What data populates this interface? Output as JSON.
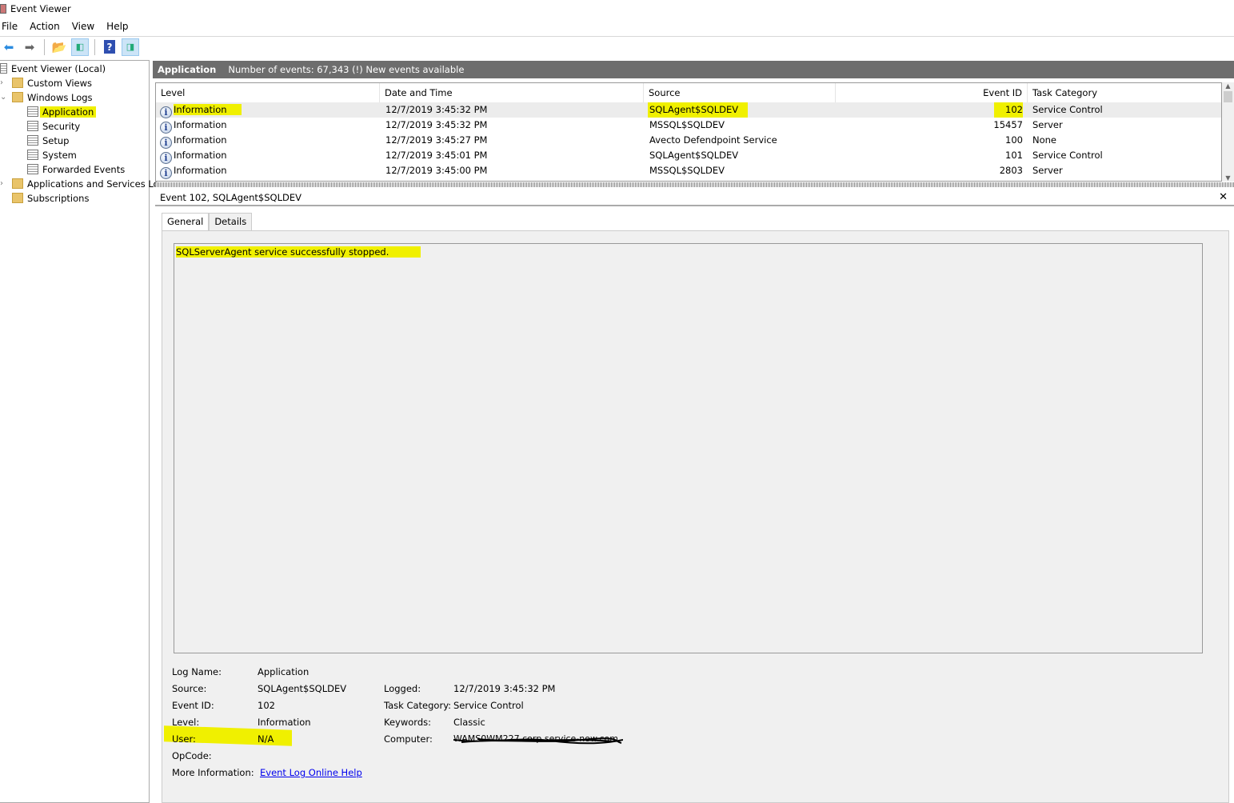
{
  "window": {
    "title": "Event Viewer"
  },
  "menu": [
    "File",
    "Action",
    "View",
    "Help"
  ],
  "toolbar": {
    "icons": [
      "back-arrow-icon",
      "forward-arrow-icon",
      "up-folder-icon",
      "show-hide-tree-icon",
      "help-icon",
      "show-hide-action-pane-icon"
    ]
  },
  "tree": {
    "root": "Event Viewer (Local)",
    "custom_views": "Custom Views",
    "windows_logs": "Windows Logs",
    "logs": [
      "Application",
      "Security",
      "Setup",
      "System",
      "Forwarded Events"
    ],
    "app_services": "Applications and Services Lo",
    "subscriptions": "Subscriptions"
  },
  "header": {
    "title": "Application",
    "summary": "Number of events: 67,343 (!) New events available"
  },
  "grid": {
    "columns": [
      "Level",
      "Date and Time",
      "Source",
      "Event ID",
      "Task Category"
    ],
    "rows": [
      {
        "level": "Information",
        "date": "12/7/2019 3:45:32 PM",
        "source": "SQLAgent$SQLDEV",
        "id": "102",
        "category": "Service Control"
      },
      {
        "level": "Information",
        "date": "12/7/2019 3:45:32 PM",
        "source": "MSSQL$SQLDEV",
        "id": "15457",
        "category": "Server"
      },
      {
        "level": "Information",
        "date": "12/7/2019 3:45:27 PM",
        "source": "Avecto Defendpoint Service",
        "id": "100",
        "category": "None"
      },
      {
        "level": "Information",
        "date": "12/7/2019 3:45:01 PM",
        "source": "SQLAgent$SQLDEV",
        "id": "101",
        "category": "Service Control"
      },
      {
        "level": "Information",
        "date": "12/7/2019 3:45:00 PM",
        "source": "MSSQL$SQLDEV",
        "id": "2803",
        "category": "Server"
      }
    ]
  },
  "event": {
    "title": "Event 102, SQLAgent$SQLDEV",
    "tabs": [
      "General",
      "Details"
    ],
    "message": "SQLServerAgent service successfully stopped.",
    "labels": {
      "log_name": "Log Name:",
      "source": "Source:",
      "event_id": "Event ID:",
      "level": "Level:",
      "user": "User:",
      "opcode": "OpCode:",
      "more_info": "More Information:",
      "logged": "Logged:",
      "task_category": "Task Category:",
      "keywords": "Keywords:",
      "computer": "Computer:"
    },
    "values": {
      "log_name": "Application",
      "source": "SQLAgent$SQLDEV",
      "event_id": "102",
      "level": "Information",
      "user": "N/A",
      "opcode": "",
      "more_info": "Event Log Online Help",
      "logged": "12/7/2019 3:45:32 PM",
      "task_category": "Service Control",
      "keywords": "Classic",
      "computer": "WAMS0WM227.corp.service-now.com"
    }
  },
  "colors": {
    "highlight": "#f0f000",
    "header_bar": "#6d6d6d",
    "link": "#0000ee"
  }
}
